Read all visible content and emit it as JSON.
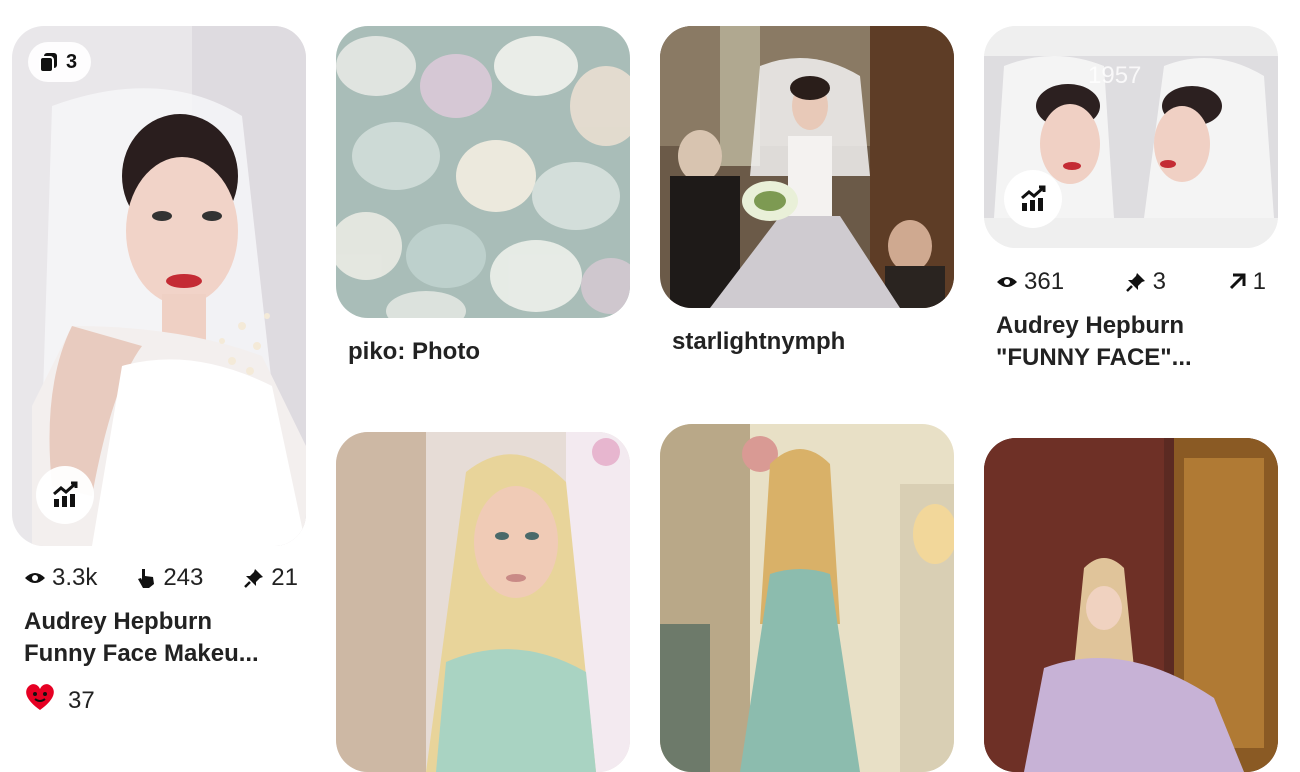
{
  "pins": [
    {
      "badge_count": "3",
      "stats": {
        "views": "3.3k",
        "clicks": "243",
        "saves": "21"
      },
      "title_line1": "Audrey Hepburn",
      "title_line2": "Funny Face Makeu...",
      "reactions": "37"
    },
    {
      "title": "piko: Photo"
    },
    {
      "title": "starlightnymph"
    },
    {
      "image_text": "1957",
      "stats": {
        "views": "361",
        "saves": "3",
        "outbound": "1"
      },
      "title_line1": "Audrey Hepburn",
      "title_line2": "\"FUNNY FACE\"..."
    }
  ],
  "icons": {
    "boards": "stack-icon",
    "analytics": "analytics-chart-icon",
    "views": "eye-icon",
    "clicks": "hand-pointer-icon",
    "saves": "pin-icon",
    "outbound": "arrow-up-right-icon",
    "reaction": "heart-face-icon"
  },
  "colors": {
    "text": "#222222",
    "reaction": "#e60023",
    "background": "#ffffff"
  }
}
